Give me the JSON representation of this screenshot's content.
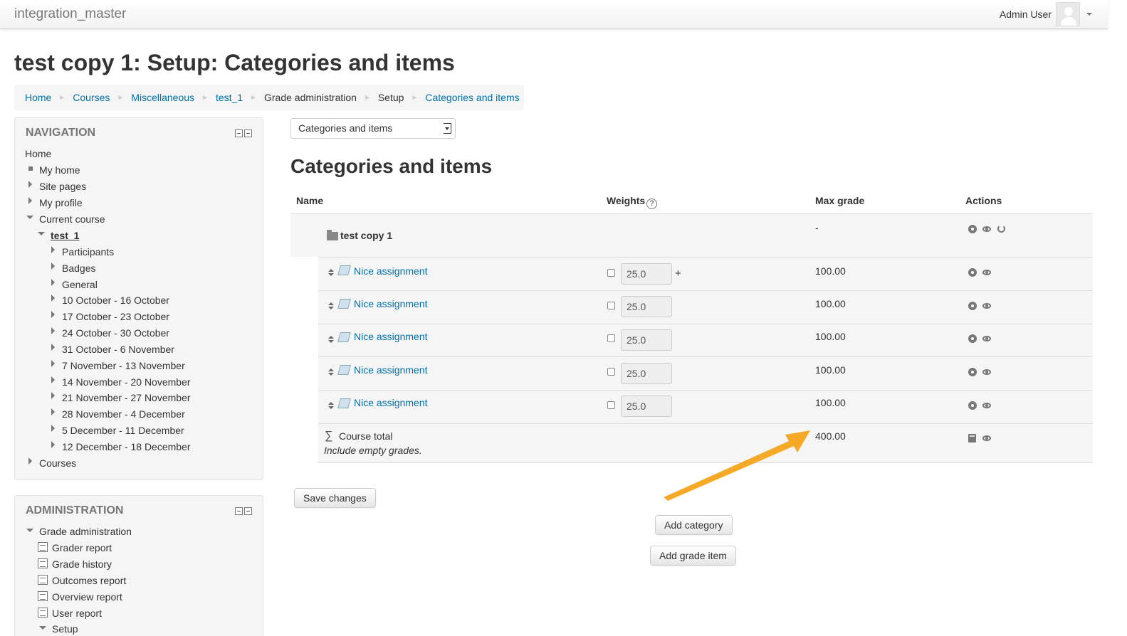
{
  "app": {
    "site_name": "integration_master",
    "user_name": "Admin User"
  },
  "page_title": "test copy 1: Setup: Categories and items",
  "breadcrumb": [
    "Home",
    "Courses",
    "Miscellaneous",
    "test_1",
    "Grade administration",
    "Setup",
    "Categories and items"
  ],
  "navigation": {
    "header": "NAVIGATION",
    "items": {
      "home": "Home",
      "my_home": "My home",
      "site_pages": "Site pages",
      "my_profile": "My profile",
      "current_course": "Current course",
      "course": "test_1",
      "participants": "Participants",
      "badges": "Badges",
      "general": "General",
      "weeks": [
        "10 October - 16 October",
        "17 October - 23 October",
        "24 October - 30 October",
        "31 October - 6 November",
        "7 November - 13 November",
        "14 November - 20 November",
        "21 November - 27 November",
        "28 November - 4 December",
        "5 December - 11 December",
        "12 December - 18 December"
      ],
      "courses": "Courses"
    }
  },
  "administration": {
    "header": "ADMINISTRATION",
    "grade_admin": "Grade administration",
    "reports": [
      "Grader report",
      "Grade history",
      "Outcomes report",
      "Overview report",
      "User report"
    ],
    "setup": "Setup"
  },
  "jump_select": {
    "selected": "Categories and items"
  },
  "section_title": "Categories and items",
  "table": {
    "headers": {
      "name": "Name",
      "weights": "Weights",
      "max_grade": "Max grade",
      "actions": "Actions"
    },
    "category": {
      "name": "test copy 1",
      "max_grade": "-"
    },
    "items": [
      {
        "name": "Nice assignment",
        "weight": "25.0",
        "max_grade": "100.00"
      },
      {
        "name": "Nice assignment",
        "weight": "25.0",
        "max_grade": "100.00"
      },
      {
        "name": "Nice assignment",
        "weight": "25.0",
        "max_grade": "100.00"
      },
      {
        "name": "Nice assignment",
        "weight": "25.0",
        "max_grade": "100.00"
      },
      {
        "name": "Nice assignment",
        "weight": "25.0",
        "max_grade": "100.00"
      }
    ],
    "total": {
      "name": "Course total",
      "note": "Include empty grades.",
      "max_grade": "400.00"
    },
    "plus": "+"
  },
  "buttons": {
    "save": "Save changes",
    "add_category": "Add category",
    "add_grade_item": "Add grade item"
  },
  "colors": {
    "link": "#0070a8",
    "arrow": "#f5a41a"
  }
}
